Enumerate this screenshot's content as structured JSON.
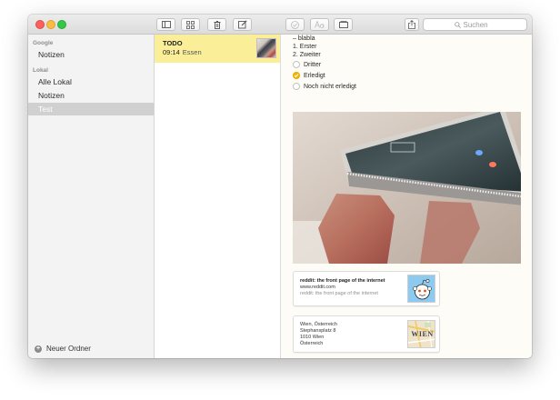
{
  "toolbar": {
    "search": {
      "placeholder": "Suchen"
    }
  },
  "sidebar": {
    "groups": [
      {
        "header": "Google",
        "items": [
          {
            "label": "Notizen"
          }
        ]
      },
      {
        "header": "Lokal",
        "items": [
          {
            "label": "Alle Lokal"
          },
          {
            "label": "Notizen"
          },
          {
            "label": "Test",
            "selected": true
          }
        ]
      }
    ],
    "new_folder_label": "Neuer Ordner"
  },
  "note_list": {
    "notes": [
      {
        "title": "TODO",
        "time": "09:14",
        "preview": "Essen",
        "selected": true
      }
    ]
  },
  "editor": {
    "lines": [
      "– blabla",
      "1. Erster",
      "2. Zweiter"
    ],
    "checklist": [
      {
        "label": "Dritter",
        "checked": false
      },
      {
        "label": "Erledigt",
        "checked": true
      },
      {
        "label": "Noch nicht erledigt",
        "checked": false
      }
    ],
    "link_card": {
      "title": "reddit: the front page of the internet",
      "url": "www.reddit.com",
      "description": "reddit: the front page of the internet"
    },
    "map_card": {
      "lines": [
        "Wien, Österreich",
        "Stephansplatz 8",
        "1010 Wien",
        "Österreich"
      ],
      "thumb_label": "WIEN"
    }
  },
  "colors": {
    "note_highlight": "#fbee98",
    "check_accent": "#f7b500",
    "close": "#fc605c",
    "minimize": "#fdbc40",
    "maximize": "#34c84a"
  }
}
